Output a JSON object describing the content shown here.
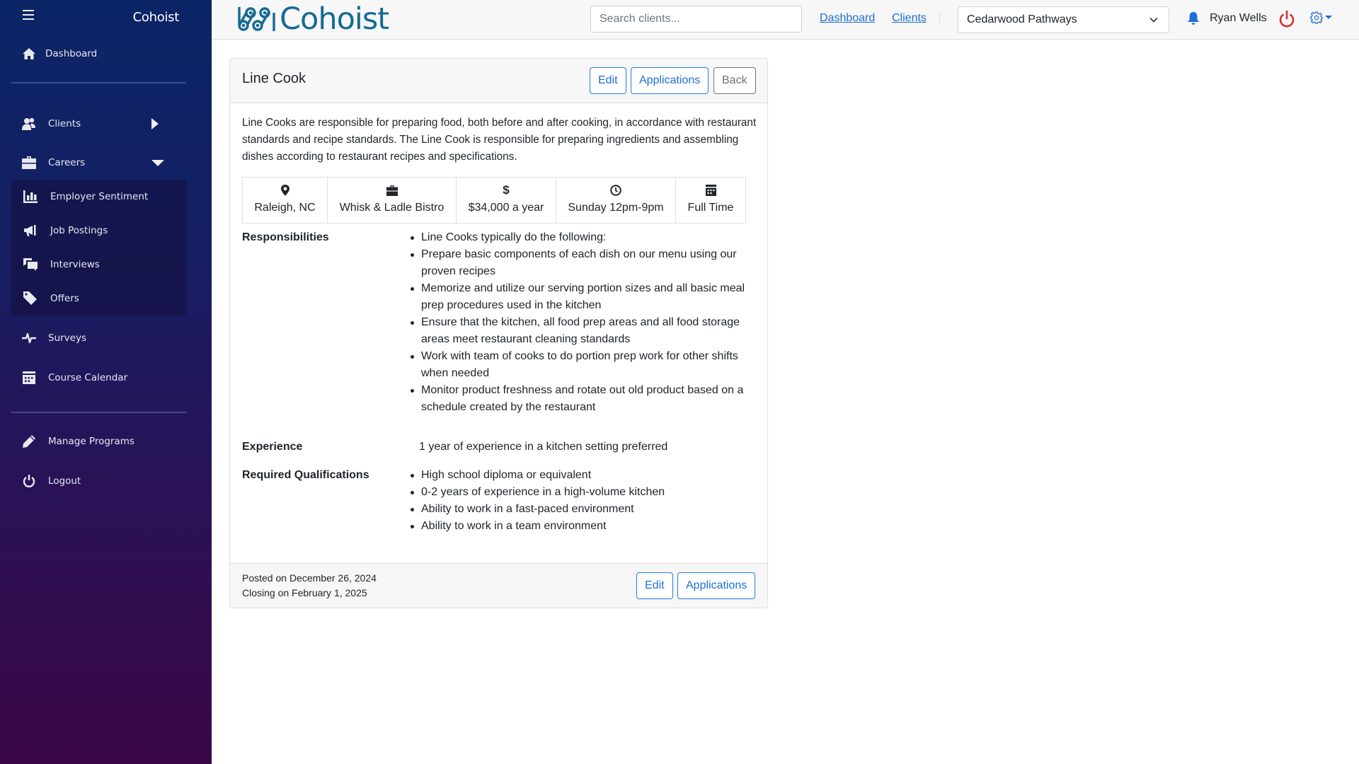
{
  "sidebar": {
    "brand": "Cohoist",
    "items": [
      {
        "label": "Dashboard",
        "icon": "home-icon"
      },
      {
        "label": "Clients",
        "icon": "users-icon"
      },
      {
        "label": "Careers",
        "icon": "briefcase-icon"
      },
      {
        "label": "Employer Sentiment",
        "icon": "bar-chart-icon"
      },
      {
        "label": "Job Postings",
        "icon": "megaphone-icon"
      },
      {
        "label": "Interviews",
        "icon": "comments-icon"
      },
      {
        "label": "Offers",
        "icon": "tag-icon"
      },
      {
        "label": "Surveys",
        "icon": "heartbeat-icon"
      },
      {
        "label": "Course Calendar",
        "icon": "calendar-icon"
      },
      {
        "label": "Manage Programs",
        "icon": "pencil-icon"
      },
      {
        "label": "Logout",
        "icon": "power-icon"
      }
    ]
  },
  "header": {
    "logo_text": "Cohoist",
    "search_placeholder": "Search clients...",
    "search_value": "",
    "links": [
      "Dashboard",
      "Clients"
    ],
    "program_select": "Cedarwood Pathways",
    "user_name": "Ryan Wells"
  },
  "colors": {
    "sidebar_top": "#0b2566",
    "sidebar_bottom": "#3a0645",
    "logo": "#166a96",
    "link": "#1d6fd6",
    "power": "#d32f2f",
    "bell": "#1d6fd6"
  },
  "job": {
    "title": "Line Cook",
    "buttons": {
      "edit": "Edit",
      "applications": "Applications",
      "back": "Back"
    },
    "description": "Line Cooks are responsible for preparing food, both before and after cooking, in accordance with restaurant standards and recipe standards. The Line Cook is responsible for preparing ingredients and assembling dishes according to restaurant recipes and specifications.",
    "meta": [
      {
        "icon": "map-marker-icon",
        "text": "Raleigh, NC"
      },
      {
        "icon": "briefcase-icon",
        "text": "Whisk & Ladle Bistro"
      },
      {
        "icon": "dollar-icon",
        "text": "$34,000 a year"
      },
      {
        "icon": "clock-icon",
        "text": "Sunday 12pm-9pm"
      },
      {
        "icon": "calendar-icon",
        "text": "Full Time"
      }
    ],
    "responsibilities_label": "Responsibilities",
    "responsibilities": [
      "Line Cooks typically do the following:",
      "Prepare basic components of each dish on our menu using our proven recipes",
      "Memorize and utilize our serving portion sizes and all basic meal prep procedures used in the kitchen",
      "Ensure that the kitchen, all food prep areas and all food storage areas meet restaurant cleaning standards",
      "Work with team of cooks to do portion prep work for other shifts when needed",
      "Monitor product freshness and rotate out old product based on a schedule created by the restaurant"
    ],
    "experience_label": "Experience",
    "experience": "1 year of experience in a kitchen setting preferred",
    "qualifications_label": "Required Qualifications",
    "qualifications": [
      "High school diploma or equivalent",
      "0-2 years of experience in a high-volume kitchen",
      "Ability to work in a fast-paced environment",
      "Ability to work in a team environment"
    ],
    "posted": "Posted on December 26, 2024",
    "closing": "Closing on February 1, 2025",
    "footer_buttons": {
      "edit": "Edit",
      "applications": "Applications"
    }
  }
}
